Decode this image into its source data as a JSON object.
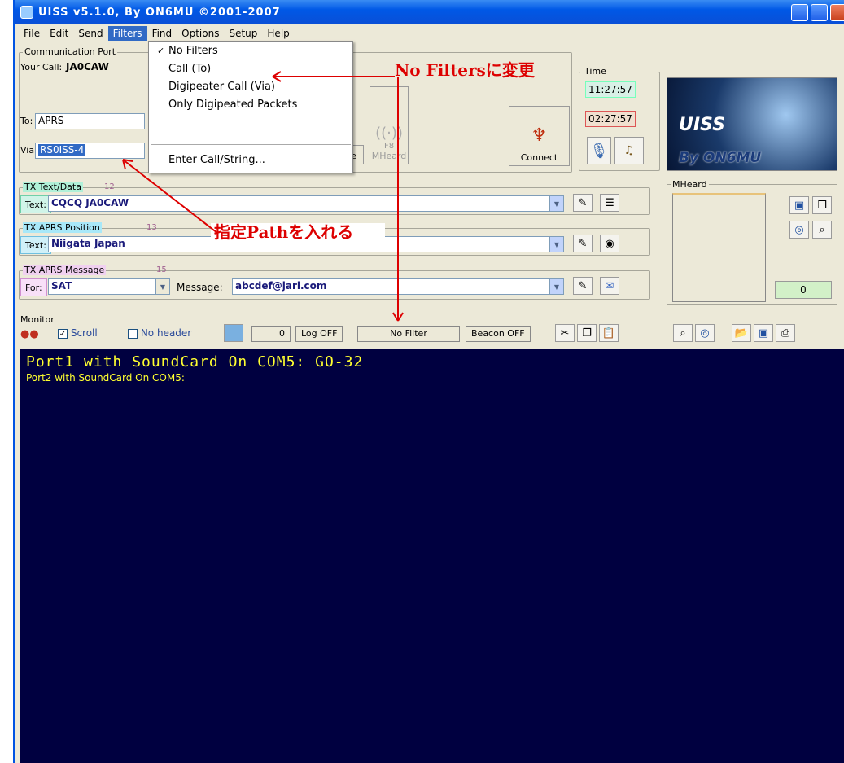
{
  "window": {
    "title": "UISS v5.1.0, By ON6MU ©2001-2007"
  },
  "menu": [
    "File",
    "Edit",
    "Send",
    "Filters",
    "Find",
    "Options",
    "Setup",
    "Help"
  ],
  "filters_menu": {
    "items": [
      "No Filters",
      "Call (To)",
      "Digipeater Call (Via)",
      "Only Digipeated Packets",
      "Enter Call/String..."
    ],
    "checked": "No Filters"
  },
  "comm": {
    "group_title": "Communication Port",
    "your_call_label": "Your Call:",
    "your_call": "JA0CAW",
    "to_label": "To:",
    "to_value": "APRS",
    "via_label": "Via:",
    "via_value": "RS0ISS-4",
    "btn_ge": "ge",
    "btn_mheard": "MHeard",
    "btn_f8": "F8",
    "btn_connect": "Connect"
  },
  "time": {
    "label": "Time",
    "local": "11:27:57",
    "utc": "02:27:57"
  },
  "logo": {
    "title": "UISS",
    "by": "By ON6MU"
  },
  "tx_text": {
    "group": "TX Text/Data",
    "num": "12",
    "tag": "Text:",
    "value": "CQCQ  JA0CAW"
  },
  "tx_pos": {
    "group": "TX APRS Position",
    "num": "13",
    "tag": "Text:",
    "value": "Niigata Japan"
  },
  "tx_msg": {
    "group": "TX APRS Message",
    "num": "15",
    "for_tag": "For:",
    "for_value": "SAT",
    "msg_label": "Message:",
    "msg_value": "abcdef@jarl.com"
  },
  "mheard": {
    "title": "MHeard",
    "count": "0"
  },
  "monitor": {
    "group": "Monitor",
    "scroll": "Scroll",
    "no_header": "No header",
    "counter": "0",
    "log": "Log OFF",
    "filter": "No Filter",
    "beacon": "Beacon OFF",
    "lines": [
      "Port1 with SoundCard On COM5: GO-32",
      "Port2 with SoundCard On COM5:"
    ]
  },
  "annotations": {
    "top": "No Filtersに変更",
    "path": "指定Pathを入れる"
  },
  "colors": {
    "title_blue": "#0058e6",
    "monitor_bg": "#000040",
    "monitor_text": "#ffff30",
    "annotation": "#dd0000",
    "menu_highlight": "#316ac5"
  }
}
